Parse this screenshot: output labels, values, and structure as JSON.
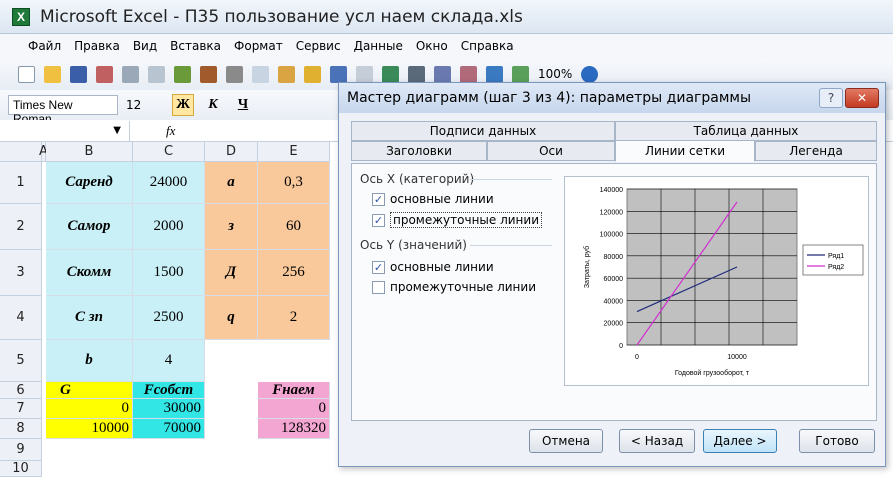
{
  "window": {
    "title": "Microsoft Excel - П35 пользование усл наем склада.xls",
    "app_icon_label": "X"
  },
  "menu": [
    "Файл",
    "Правка",
    "Вид",
    "Вставка",
    "Формат",
    "Сервис",
    "Данные",
    "Окно",
    "Справка"
  ],
  "toolbar": {
    "zoom": "100%"
  },
  "format_bar": {
    "font": "Times New Roman",
    "size": "12",
    "bold": "Ж",
    "italic": "К",
    "underline": "Ч"
  },
  "formula_bar": {
    "fx": "fx"
  },
  "sheet": {
    "columns": [
      "A",
      "B",
      "C",
      "D",
      "E"
    ],
    "rows": [
      "1",
      "2",
      "3",
      "4",
      "5",
      "6",
      "7",
      "8",
      "9",
      "10"
    ],
    "cells": {
      "B1": "Саренд",
      "C1": "24000",
      "D1": "a",
      "E1": "0,3",
      "B2": "Самор",
      "C2": "2000",
      "D2": "з",
      "E2": "60",
      "B3": "Скомм",
      "C3": "1500",
      "D3": "Д",
      "E3": "256",
      "B4": "С зп",
      "C4": "2500",
      "D4": "q",
      "E4": "2",
      "B5": "b",
      "C5": "4",
      "B6": "G",
      "C6": "Fсобст",
      "E6": "Fнаем",
      "B7": "0",
      "C7": "30000",
      "E7": "0",
      "B8": "10000",
      "C8": "70000",
      "E8": "128320"
    }
  },
  "dialog": {
    "title": "Мастер диаграмм (шаг 3 из 4): параметры диаграммы",
    "help": "?",
    "close": "✕",
    "tabs_top": [
      "Подписи данных",
      "Таблица данных"
    ],
    "tabs_bottom": [
      "Заголовки",
      "Оси",
      "Линии сетки",
      "Легенда"
    ],
    "active_tab": "Линии сетки",
    "x_group": "Ось X (категорий)",
    "x_major": "основные линии",
    "x_minor": "промежуточные линии",
    "y_group": "Ось Y (значений)",
    "y_major": "основные линии",
    "y_minor": "промежуточные линии",
    "check_x_major": true,
    "check_x_minor": true,
    "check_y_major": true,
    "check_y_minor": false,
    "buttons": {
      "cancel": "Отмена",
      "back": "< Назад",
      "next": "Далее >",
      "finish": "Готово"
    }
  },
  "chart_data": {
    "type": "line",
    "xlabel": "Годовой грузооборот, т",
    "ylabel": "Затраты, руб",
    "x": [
      0,
      10000
    ],
    "xticks": [
      "0",
      "10000"
    ],
    "ylim": [
      0,
      140000
    ],
    "yticks": [
      "0",
      "20000",
      "40000",
      "60000",
      "80000",
      "100000",
      "120000",
      "140000"
    ],
    "grid": true,
    "legend_position": "right",
    "series": [
      {
        "name": "Ряд1",
        "values": [
          30000,
          70000
        ],
        "color": "#1f2a7a"
      },
      {
        "name": "Ряд2",
        "values": [
          0,
          128320
        ],
        "color": "#d02fd0"
      }
    ]
  }
}
